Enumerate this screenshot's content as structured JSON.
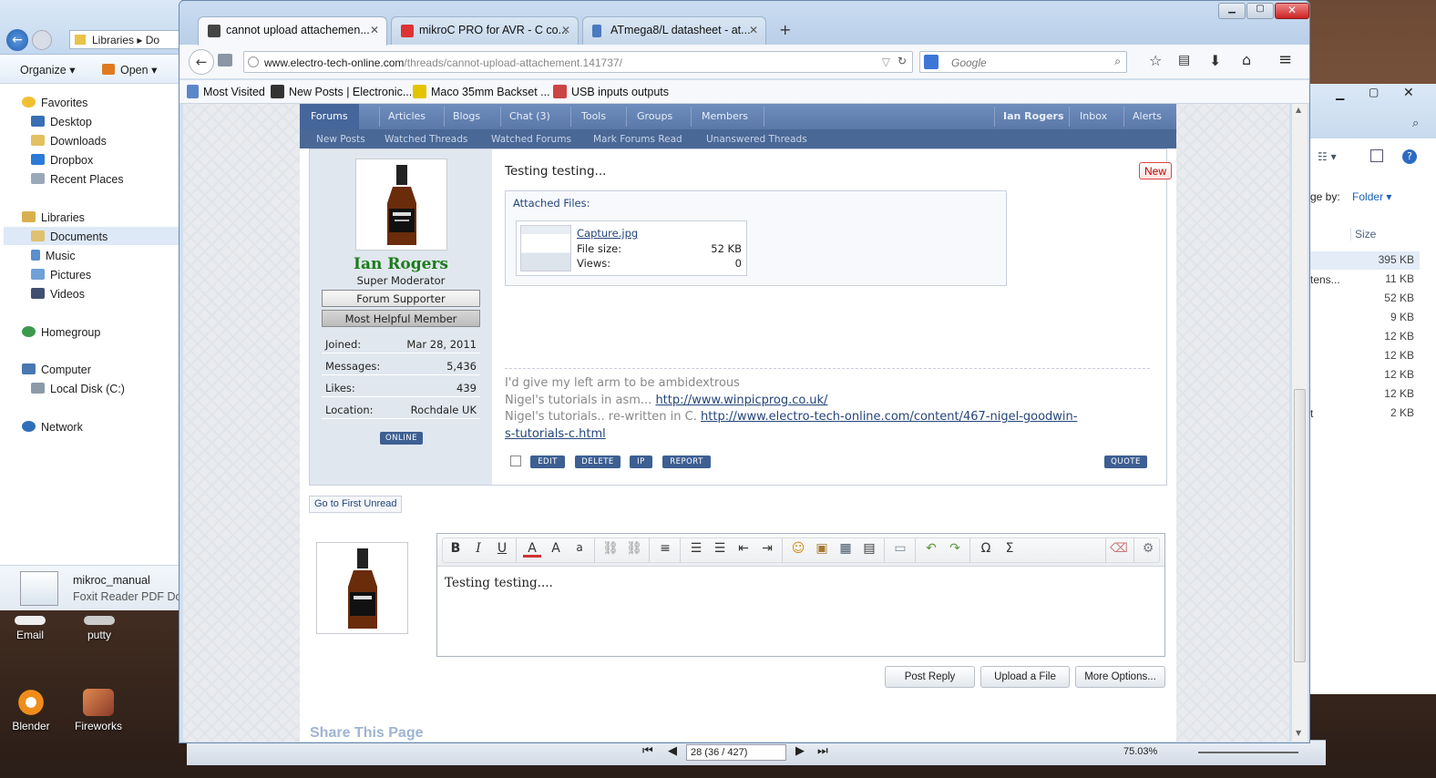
{
  "explorer": {
    "address_root": "Libraries",
    "address_next": "Do",
    "organize": "Organize",
    "open": "Open",
    "favorites_header": "Favorites",
    "favorites": [
      "Desktop",
      "Downloads",
      "Dropbox",
      "Recent Places"
    ],
    "libraries_header": "Libraries",
    "libraries": [
      "Documents",
      "Music",
      "Pictures",
      "Videos"
    ],
    "homegroup": "Homegroup",
    "computer": "Computer",
    "local_disk": "Local Disk (C:)",
    "network": "Network",
    "selected_file_name": "mikroc_manual",
    "selected_file_type": "Foxit Reader PDF Docu"
  },
  "explorer_right": {
    "arrange_by_label": "ge by:",
    "arrange_by_value": "Folder",
    "size_header": "Size",
    "sizes": [
      "395 KB",
      "11 KB",
      "52 KB",
      "9 KB",
      "12 KB",
      "12 KB",
      "12 KB",
      "12 KB",
      "2 KB"
    ],
    "name_fragments": [
      "tens...",
      "t"
    ]
  },
  "desktop_icons": [
    {
      "label": "Email"
    },
    {
      "label": "putty"
    },
    {
      "label": "Blender"
    },
    {
      "label": "Fireworks"
    }
  ],
  "pdf_reader": {
    "page_field": "28 (36 / 427)",
    "zoom": "75.03%"
  },
  "browser": {
    "tabs": [
      {
        "title": "cannot upload attachemen..."
      },
      {
        "title": "mikroC PRO for AVR - C co..."
      },
      {
        "title": "ATmega8/L datasheet - at..."
      }
    ],
    "new_tab": "+",
    "url_host": "www.electro-tech-online.com",
    "url_path": "/threads/cannot-upload-attachement.141737/",
    "search_placeholder": "Google",
    "bookmarks": [
      "Most Visited",
      "New Posts | Electronic...",
      "Maco 35mm Backset ...",
      "USB inputs outputs"
    ]
  },
  "forum": {
    "nav": [
      "Forums",
      "Articles",
      "Blogs",
      "Chat (3)",
      "Tools",
      "Groups",
      "Members"
    ],
    "nav_right": [
      "Ian Rogers",
      "Inbox",
      "Alerts"
    ],
    "subnav": [
      "New Posts",
      "Watched Threads",
      "Watched Forums",
      "Mark Forums Read",
      "Unanswered Threads"
    ],
    "post": {
      "username": "Ian Rogers",
      "user_title": "Super Moderator",
      "banners": [
        "Forum Supporter",
        "Most Helpful Member"
      ],
      "stats": [
        {
          "label": "Joined:",
          "value": "Mar 28, 2011"
        },
        {
          "label": "Messages:",
          "value": "5,436"
        },
        {
          "label": "Likes:",
          "value": "439"
        },
        {
          "label": "Location:",
          "value": "Rochdale UK"
        }
      ],
      "online": "ONLINE",
      "body": "Testing testing...",
      "new_badge": "New",
      "attached_files_label": "Attached Files:",
      "attachment": {
        "name": "Capture.jpg",
        "size_label": "File size:",
        "size_value": "52 KB",
        "views_label": "Views:",
        "views_value": "0"
      },
      "signature_line1": "I'd give my left arm to be ambidextrous",
      "signature_line2_prefix": "Nigel's tutorials in asm...",
      "signature_line2_link": "http://www.winpicprog.co.uk/",
      "signature_line3_prefix": "Nigel's tutorials.. re-written in C.",
      "signature_line3_link_a": "http://www.electro-tech-online.com/content/467-nigel-goodwin-",
      "signature_line3_link_b": "s-tutorials-c.html",
      "actions": [
        "EDIT",
        "DELETE",
        "IP",
        "REPORT"
      ],
      "quote": "QUOTE"
    },
    "go_first_unread": "Go to First Unread",
    "editor_text": "Testing testing....",
    "buttons": [
      "Post Reply",
      "Upload a File",
      "More Options..."
    ],
    "share_heading": "Share This Page"
  }
}
